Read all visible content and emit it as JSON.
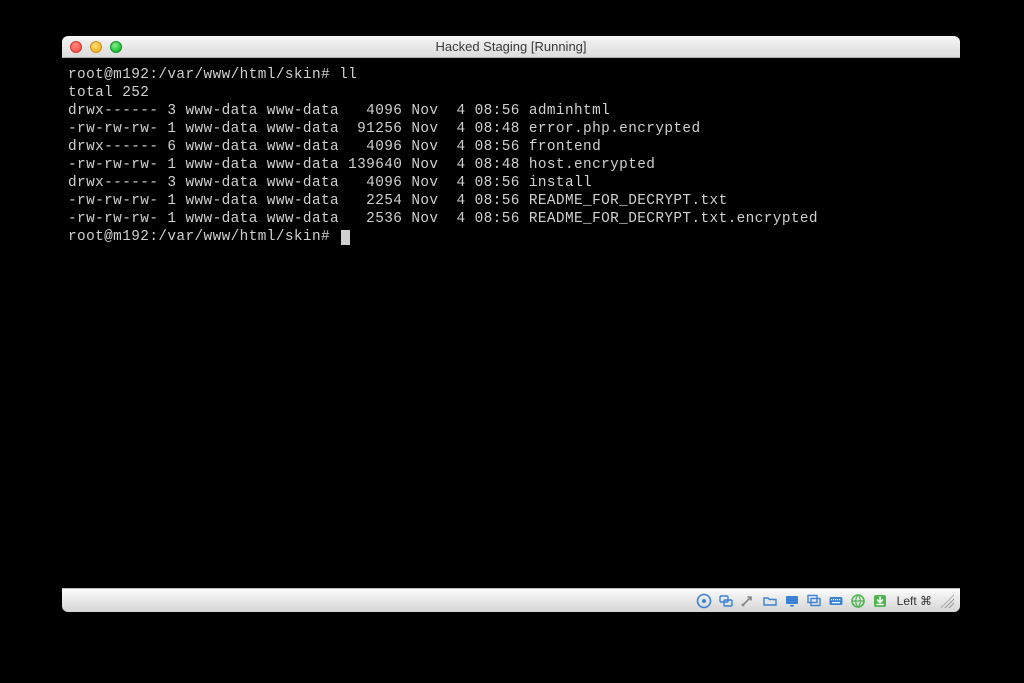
{
  "window": {
    "title": "Hacked Staging [Running]"
  },
  "terminal": {
    "prompt1": "root@m192:/var/www/html/skin# ll",
    "total_line": "total 252",
    "rows": [
      {
        "perm": "drwx------",
        "links": "3",
        "owner": "www-data",
        "group": "www-data",
        "size": "4096",
        "mon": "Nov",
        "day": "4",
        "time": "08:56",
        "name": "adminhtml"
      },
      {
        "perm": "-rw-rw-rw-",
        "links": "1",
        "owner": "www-data",
        "group": "www-data",
        "size": "91256",
        "mon": "Nov",
        "day": "4",
        "time": "08:48",
        "name": "error.php.encrypted"
      },
      {
        "perm": "drwx------",
        "links": "6",
        "owner": "www-data",
        "group": "www-data",
        "size": "4096",
        "mon": "Nov",
        "day": "4",
        "time": "08:56",
        "name": "frontend"
      },
      {
        "perm": "-rw-rw-rw-",
        "links": "1",
        "owner": "www-data",
        "group": "www-data",
        "size": "139640",
        "mon": "Nov",
        "day": "4",
        "time": "08:48",
        "name": "host.encrypted"
      },
      {
        "perm": "drwx------",
        "links": "3",
        "owner": "www-data",
        "group": "www-data",
        "size": "4096",
        "mon": "Nov",
        "day": "4",
        "time": "08:56",
        "name": "install"
      },
      {
        "perm": "-rw-rw-rw-",
        "links": "1",
        "owner": "www-data",
        "group": "www-data",
        "size": "2254",
        "mon": "Nov",
        "day": "4",
        "time": "08:56",
        "name": "README_FOR_DECRYPT.txt"
      },
      {
        "perm": "-rw-rw-rw-",
        "links": "1",
        "owner": "www-data",
        "group": "www-data",
        "size": "2536",
        "mon": "Nov",
        "day": "4",
        "time": "08:56",
        "name": "README_FOR_DECRYPT.txt.encrypted"
      }
    ],
    "prompt2": "root@m192:/var/www/html/skin# "
  },
  "statusbar": {
    "text": "Left ⌘",
    "icons": [
      "disc-icon",
      "network-icon",
      "usb-icon",
      "folder-icon",
      "display-icon",
      "windows-icon",
      "keyboard-icon",
      "globe-icon",
      "download-icon"
    ],
    "colors": {
      "blue": "#3b82d6",
      "green": "#4fb54f",
      "gray": "#888888"
    }
  }
}
